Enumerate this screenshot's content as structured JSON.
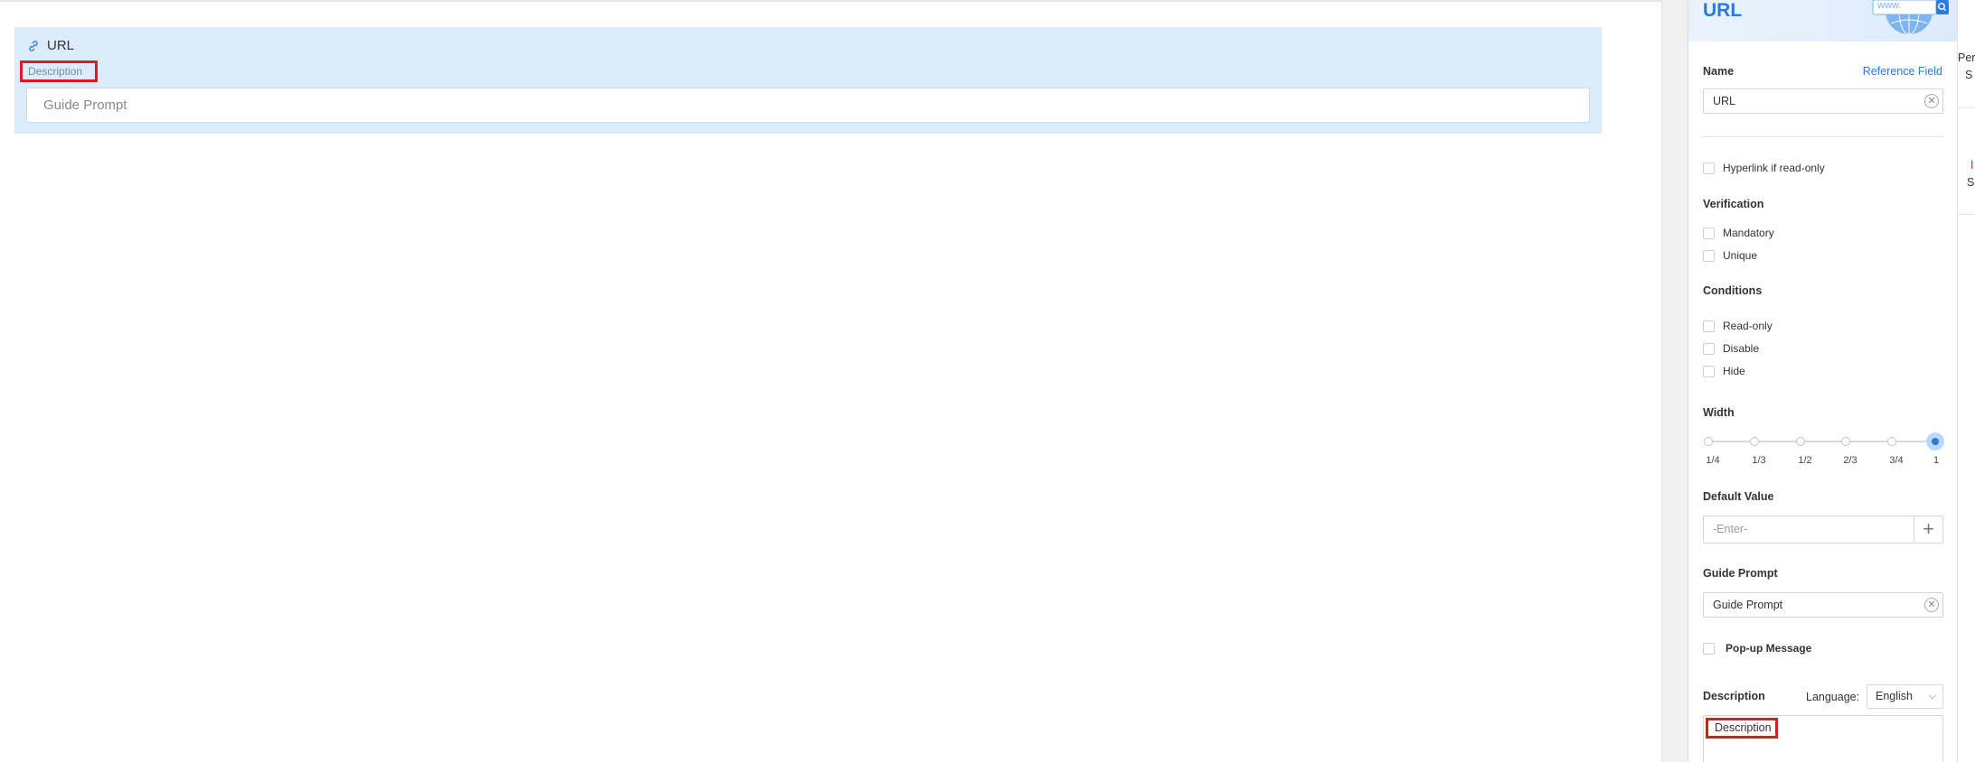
{
  "canvas": {
    "field": {
      "title": "URL",
      "description": "Description",
      "guide_prompt": "Guide Prompt"
    }
  },
  "panel": {
    "title": "URL",
    "header_art_text": "www.",
    "name_label": "Name",
    "reference_field_link": "Reference Field",
    "name_value": "URL",
    "hyperlink_label": "Hyperlink if read-only",
    "verification_label": "Verification",
    "verification": [
      "Mandatory",
      "Unique"
    ],
    "conditions_label": "Conditions",
    "conditions": [
      "Read-only",
      "Disable",
      "Hide"
    ],
    "width_label": "Width",
    "width_options": [
      "1/4",
      "1/3",
      "1/2",
      "2/3",
      "3/4",
      "1"
    ],
    "width_selected": "1",
    "default_value_label": "Default Value",
    "default_value_placeholder": "-Enter-",
    "guide_prompt_label": "Guide Prompt",
    "guide_prompt_value": "Guide Prompt",
    "popup_label": "Pop-up Message",
    "description_label": "Description",
    "language_label": "Language:",
    "language_value": "English",
    "description_value": "Description"
  },
  "side_strip": {
    "top_text_1": "Per",
    "top_text_2": "S",
    "mid_text_1": "I",
    "mid_text_2": "S"
  },
  "colors": {
    "accent": "#2a7ae2",
    "highlight_red": "#e01b1b",
    "card_bg": "#dcecfb"
  },
  "icons": {
    "field_type": "link-icon",
    "clear": "clear-circle-icon",
    "add": "plus-icon",
    "dropdown": "chevron-down-icon",
    "header_art": "globe-search-icon"
  }
}
